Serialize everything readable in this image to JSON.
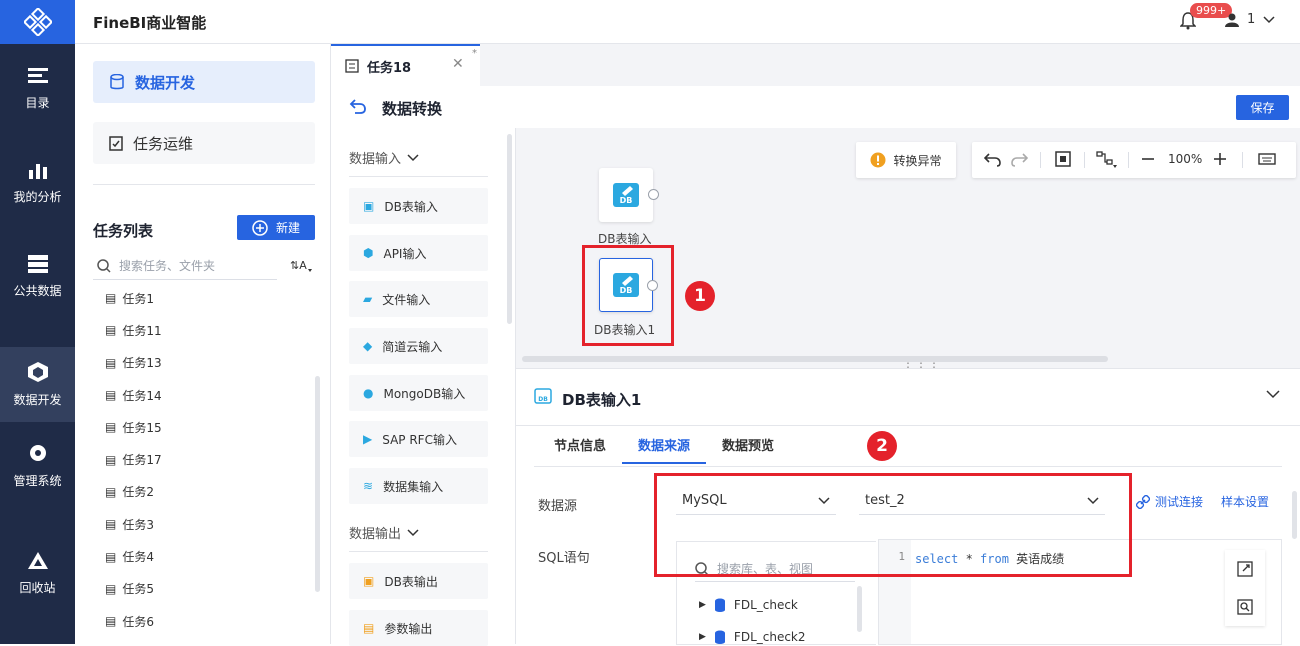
{
  "app": {
    "title": "FineBI商业智能",
    "notification_badge": "999+",
    "user_name": "1"
  },
  "nav": {
    "items": [
      {
        "label": "目录",
        "icon": "list-icon"
      },
      {
        "label": "我的分析",
        "icon": "chart-icon"
      },
      {
        "label": "公共数据",
        "icon": "database-icon"
      },
      {
        "label": "数据开发",
        "icon": "cube-icon",
        "active": true
      },
      {
        "label": "管理系统",
        "icon": "gear-icon"
      },
      {
        "label": "回收站",
        "icon": "recycle-icon"
      }
    ]
  },
  "task_panel": {
    "mode_dev": "数据开发",
    "mode_ops": "任务运维",
    "list_title": "任务列表",
    "new_label": "新建",
    "search_placeholder": "搜索任务、文件夹",
    "items": [
      "任务1",
      "任务11",
      "任务13",
      "任务14",
      "任务15",
      "任务17",
      "任务2",
      "任务3",
      "任务4",
      "任务5",
      "任务6"
    ]
  },
  "tab": {
    "label": "任务18",
    "modified_mark": "*"
  },
  "page": {
    "title": "数据转换",
    "save_label": "保存"
  },
  "palette": {
    "input_header": "数据输入",
    "inputs": [
      "DB表输入",
      "API输入",
      "文件输入",
      "简道云输入",
      "MongoDB输入",
      "SAP RFC输入",
      "数据集输入"
    ],
    "output_header": "数据输出",
    "outputs": [
      "DB表输出",
      "参数输出"
    ]
  },
  "canvas": {
    "warning_label": "转换异常",
    "zoom": "100%",
    "nodes": [
      {
        "label": "DB表输入"
      },
      {
        "label": "DB表输入1"
      }
    ],
    "callout1": "1",
    "callout2": "2"
  },
  "props": {
    "title": "DB表输入1",
    "tabs": [
      "节点信息",
      "数据来源",
      "数据预览"
    ],
    "active_tab": "数据来源",
    "datasource_label": "数据源",
    "db_type": "MySQL",
    "connection": "test_2",
    "test_connection": "测试连接",
    "sample_settings": "样本设置",
    "sql_label": "SQL语句",
    "tree_search_placeholder": "搜索库、表、视图",
    "tree_items": [
      "FDL_check",
      "FDL_check2"
    ],
    "sql_line_number": "1",
    "sql_kw_select": "select",
    "sql_star": " * ",
    "sql_kw_from": "from",
    "sql_table": " 英语成绩"
  },
  "colors": {
    "accent": "#2764e0",
    "nav_bg": "#1f2b47",
    "highlight_red": "#e4222b"
  }
}
